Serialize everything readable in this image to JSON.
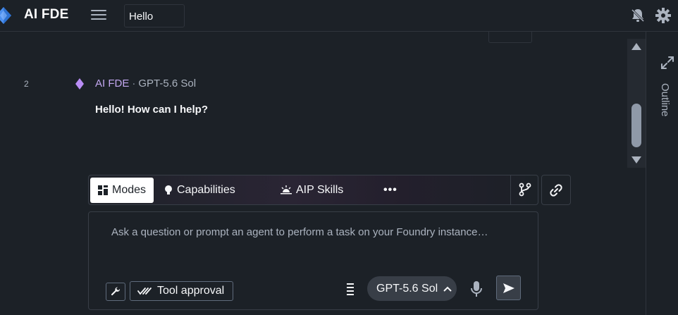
{
  "header": {
    "app_title": "AI FDE",
    "tab_title": "Hello",
    "icons": [
      "logo-icon",
      "menu-icon",
      "notification-bell-icon",
      "gear-icon"
    ]
  },
  "conversation": {
    "line_number": "2",
    "sender_name": "AI FDE",
    "separator": "·",
    "model": "GPT-5.6 Sol",
    "message": "Hello! How can I help?"
  },
  "sidebar": {
    "outline_label": "Outline"
  },
  "toolbar": {
    "modes_label": "Modes",
    "capabilities_label": "Capabilities",
    "aip_skills_label": "AIP Skills",
    "more_label": "•••"
  },
  "prompt": {
    "placeholder": "Ask a question or prompt an agent to perform a task on your Foundry instance…",
    "value": "",
    "tool_approval_label": "Tool approval",
    "model_label": "GPT-5.6 Sol"
  },
  "colors": {
    "background": "#1c2127",
    "accent_purple": "#c3a8f0",
    "text_primary": "#f6f7f9",
    "text_muted": "#abb3bf"
  }
}
